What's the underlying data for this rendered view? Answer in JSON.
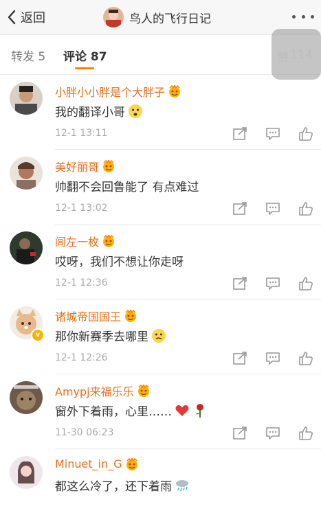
{
  "header": {
    "back_label": "返回",
    "title": "鸟人的飞行日记"
  },
  "tabs": {
    "repost": "转发 5",
    "comment": "评论 87",
    "like_label": "赞",
    "like_count": "114"
  },
  "comments": [
    {
      "name": "小胖小小胖是个大胖子",
      "text": "我的翻译小哥",
      "time": "12-1 13:11"
    },
    {
      "name": "美好丽哥",
      "text": "帅翻不会回鲁能了 有点难过",
      "time": "12-1 13:02"
    },
    {
      "name": "闾左一枚",
      "text": "哎呀，我们不想让你走呀",
      "time": "12-1 12:36"
    },
    {
      "name": "诸城帝国国王",
      "text": "那你新赛季去哪里",
      "time": "12-1 12:26"
    },
    {
      "name": "Amypj来福乐乐",
      "text": "窗外下着雨，心里……",
      "time": "11-30 06:23"
    },
    {
      "name": "Minuet_in_G",
      "text": "都这么冷了，还下着雨",
      "time": ""
    }
  ],
  "colors": {
    "accent": "#ff8200",
    "username": "#e86f1c"
  }
}
